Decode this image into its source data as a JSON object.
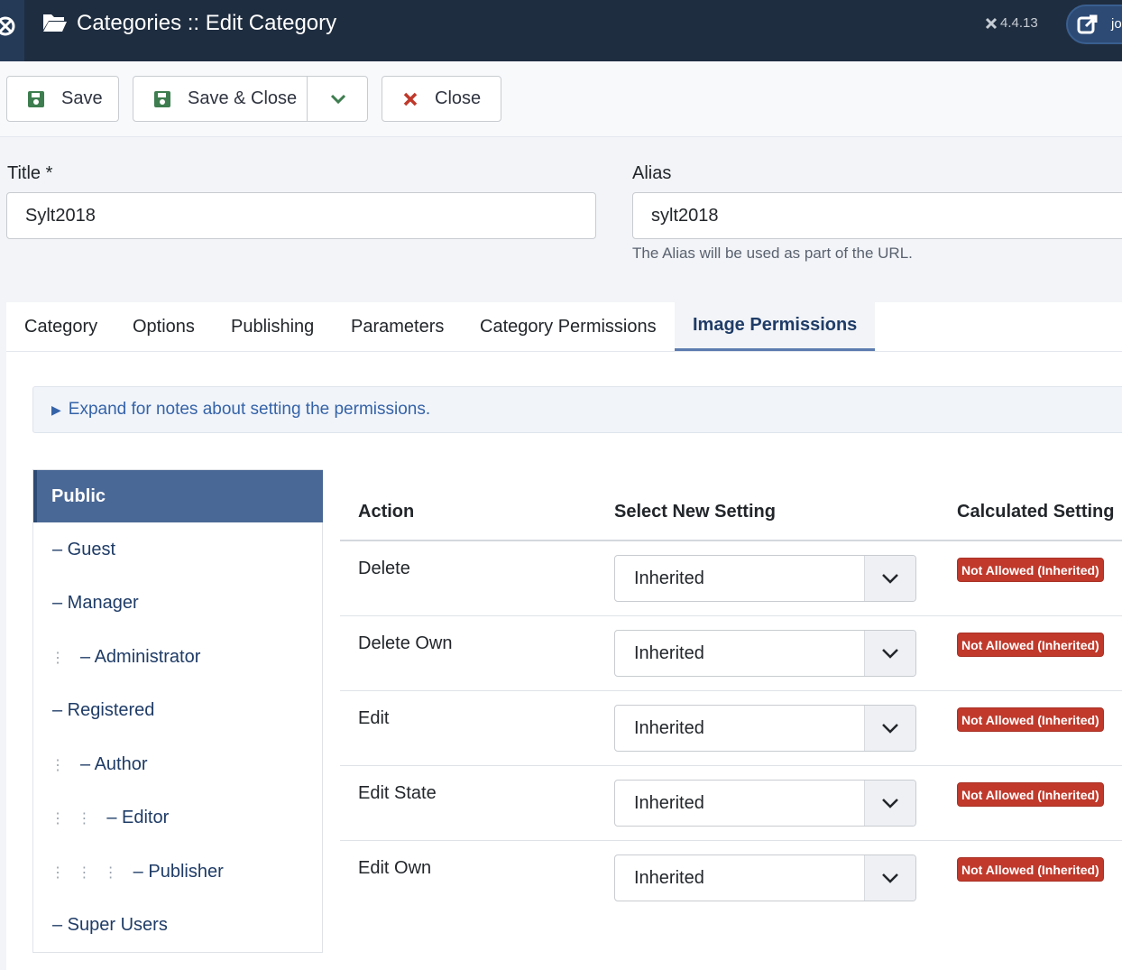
{
  "header": {
    "title": "Categories :: Edit Category",
    "version": "4.4.13",
    "user_label": "jo"
  },
  "toolbar": {
    "save_label": "Save",
    "save_close_label": "Save & Close",
    "close_label": "Close"
  },
  "form": {
    "title_label": "Title *",
    "title_value": "Sylt2018",
    "alias_label": "Alias",
    "alias_value": "sylt2018",
    "alias_hint": "The Alias will be used as part of the URL."
  },
  "tabs": [
    {
      "label": "Category",
      "active": false
    },
    {
      "label": "Options",
      "active": false
    },
    {
      "label": "Publishing",
      "active": false
    },
    {
      "label": "Parameters",
      "active": false
    },
    {
      "label": "Category Permissions",
      "active": false
    },
    {
      "label": "Image Permissions",
      "active": true
    }
  ],
  "notes": {
    "label": "Expand for notes about setting the permissions."
  },
  "groups": {
    "selected": "Public",
    "items": [
      {
        "label": "– Guest",
        "level": 0
      },
      {
        "label": "– Manager",
        "level": 0
      },
      {
        "label": "– Administrator",
        "level": 1
      },
      {
        "label": "– Registered",
        "level": 0
      },
      {
        "label": "– Author",
        "level": 1
      },
      {
        "label": "– Editor",
        "level": 2
      },
      {
        "label": "– Publisher",
        "level": 3
      },
      {
        "label": "– Super Users",
        "level": 0
      }
    ]
  },
  "permissions": {
    "headers": {
      "action": "Action",
      "select": "Select New Setting",
      "calculated": "Calculated Setting"
    },
    "rows": [
      {
        "action": "Delete",
        "setting": "Inherited",
        "calculated": "Not Allowed (Inherited)"
      },
      {
        "action": "Delete Own",
        "setting": "Inherited",
        "calculated": "Not Allowed (Inherited)"
      },
      {
        "action": "Edit",
        "setting": "Inherited",
        "calculated": "Not Allowed (Inherited)"
      },
      {
        "action": "Edit State",
        "setting": "Inherited",
        "calculated": "Not Allowed (Inherited)"
      },
      {
        "action": "Edit Own",
        "setting": "Inherited",
        "calculated": "Not Allowed (Inherited)"
      }
    ]
  },
  "colors": {
    "header_bg": "#1f2d40",
    "accent": "#4a6896",
    "danger_badge": "#c0392b",
    "save_icon": "#3e7d4f",
    "close_icon": "#c0392b"
  }
}
